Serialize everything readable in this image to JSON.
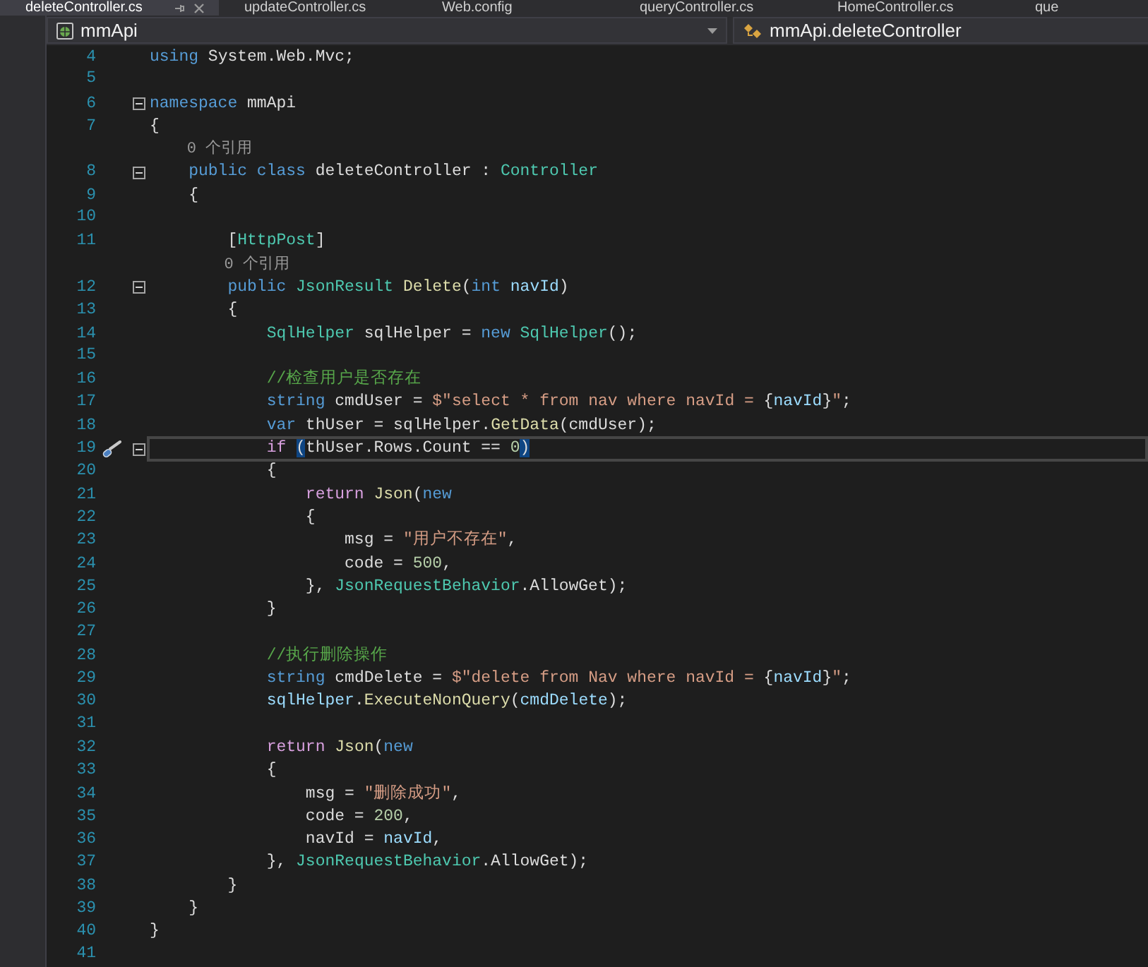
{
  "tabs": [
    {
      "label": "deleteController.cs",
      "selected": true
    },
    {
      "label": "updateController.cs",
      "selected": false
    },
    {
      "label": "Web.config",
      "selected": false
    },
    {
      "label": "queryController.cs",
      "selected": false
    },
    {
      "label": "HomeController.cs",
      "selected": false
    },
    {
      "label": "que",
      "selected": false
    }
  ],
  "navigation_bar": {
    "project": "mmApi",
    "member": "mmApi.deleteController"
  },
  "lines": [
    {
      "number": "4",
      "tokens": [
        {
          "kind": "kw",
          "text": "using"
        },
        {
          "kind": "pl",
          "text": " System.Web.Mvc;"
        }
      ]
    },
    {
      "number": "5"
    },
    {
      "number": "6",
      "fold": true,
      "tokens": [
        {
          "kind": "kw",
          "text": "namespace"
        },
        {
          "kind": "pl",
          "text": " mmApi"
        }
      ]
    },
    {
      "number": "7",
      "tokens": [
        {
          "kind": "pl",
          "text": "{"
        }
      ]
    },
    {
      "kind": "lens",
      "text": "    0 个引用"
    },
    {
      "number": "8",
      "fold": true,
      "tokens": [
        {
          "kind": "kw",
          "text": "    public"
        },
        {
          "kind": "kw",
          "text": " class"
        },
        {
          "kind": "pl",
          "text": " deleteController : "
        },
        {
          "kind": "type",
          "text": "Controller"
        }
      ]
    },
    {
      "number": "9",
      "tokens": [
        {
          "kind": "pl",
          "text": "    {"
        }
      ]
    },
    {
      "number": "10"
    },
    {
      "number": "11",
      "tokens": [
        {
          "kind": "pl",
          "text": "        ["
        },
        {
          "kind": "type",
          "text": "HttpPost"
        },
        {
          "kind": "pl",
          "text": "]"
        }
      ]
    },
    {
      "kind": "lens",
      "text": "        0 个引用"
    },
    {
      "number": "12",
      "fold": true,
      "tokens": [
        {
          "kind": "kw",
          "text": "        public"
        },
        {
          "kind": "type",
          "text": " JsonResult"
        },
        {
          "kind": "meth",
          "text": " Delete"
        },
        {
          "kind": "pl",
          "text": "("
        },
        {
          "kind": "kw",
          "text": "int"
        },
        {
          "kind": "var",
          "text": " navId"
        },
        {
          "kind": "pl",
          "text": ")"
        }
      ]
    },
    {
      "number": "13",
      "tokens": [
        {
          "kind": "pl",
          "text": "        {"
        }
      ]
    },
    {
      "number": "14",
      "tokens": [
        {
          "kind": "type",
          "text": "            SqlHelper"
        },
        {
          "kind": "pl",
          "text": " sqlHelper = "
        },
        {
          "kind": "kw",
          "text": "new"
        },
        {
          "kind": "type",
          "text": " SqlHelper"
        },
        {
          "kind": "pl",
          "text": "();"
        }
      ]
    },
    {
      "number": "15"
    },
    {
      "number": "16",
      "tokens": [
        {
          "kind": "cmt",
          "text": "            //检查用户是否存在"
        }
      ]
    },
    {
      "number": "17",
      "tokens": [
        {
          "kind": "kw",
          "text": "            string"
        },
        {
          "kind": "pl",
          "text": " cmdUser = "
        },
        {
          "kind": "str",
          "text": "$\"select * from nav where navId = "
        },
        {
          "kind": "pl",
          "text": "{"
        },
        {
          "kind": "var",
          "text": "navId"
        },
        {
          "kind": "pl",
          "text": "}"
        },
        {
          "kind": "str",
          "text": "\""
        },
        {
          "kind": "pl",
          "text": ";"
        }
      ]
    },
    {
      "number": "18",
      "tokens": [
        {
          "kind": "kw",
          "text": "            var"
        },
        {
          "kind": "pl",
          "text": " thUser = sqlHelper."
        },
        {
          "kind": "meth",
          "text": "GetData"
        },
        {
          "kind": "pl",
          "text": "(cmdUser);"
        }
      ]
    },
    {
      "number": "19",
      "fold": true,
      "current": true,
      "quick_action": true,
      "tokens": [
        {
          "kind": "ctl",
          "text": "            if "
        },
        {
          "kind": "match",
          "text": "("
        },
        {
          "kind": "pl",
          "text": "thUser.Rows.Count == "
        },
        {
          "kind": "num",
          "text": "0"
        },
        {
          "kind": "match",
          "text": ")"
        }
      ]
    },
    {
      "number": "20",
      "tokens": [
        {
          "kind": "pl",
          "text": "            {"
        }
      ]
    },
    {
      "number": "21",
      "tokens": [
        {
          "kind": "ctl",
          "text": "                return"
        },
        {
          "kind": "meth",
          "text": " Json"
        },
        {
          "kind": "pl",
          "text": "("
        },
        {
          "kind": "kw",
          "text": "new"
        }
      ]
    },
    {
      "number": "22",
      "tokens": [
        {
          "kind": "pl",
          "text": "                {"
        }
      ]
    },
    {
      "number": "23",
      "tokens": [
        {
          "kind": "pl",
          "text": "                    msg = "
        },
        {
          "kind": "str",
          "text": "\"用户不存在\""
        },
        {
          "kind": "pl",
          "text": ","
        }
      ]
    },
    {
      "number": "24",
      "tokens": [
        {
          "kind": "pl",
          "text": "                    code = "
        },
        {
          "kind": "num",
          "text": "500"
        },
        {
          "kind": "pl",
          "text": ","
        }
      ]
    },
    {
      "number": "25",
      "tokens": [
        {
          "kind": "pl",
          "text": "                }, "
        },
        {
          "kind": "type",
          "text": "JsonRequestBehavior"
        },
        {
          "kind": "pl",
          "text": ".AllowGet);"
        }
      ]
    },
    {
      "number": "26",
      "tokens": [
        {
          "kind": "pl",
          "text": "            }"
        }
      ]
    },
    {
      "number": "27"
    },
    {
      "number": "28",
      "tokens": [
        {
          "kind": "cmt",
          "text": "            //执行删除操作"
        }
      ]
    },
    {
      "number": "29",
      "tokens": [
        {
          "kind": "kw",
          "text": "            string"
        },
        {
          "kind": "pl",
          "text": " cmdDelete = "
        },
        {
          "kind": "str",
          "text": "$\"delete from Nav where navId = "
        },
        {
          "kind": "pl",
          "text": "{"
        },
        {
          "kind": "var",
          "text": "navId"
        },
        {
          "kind": "pl",
          "text": "}"
        },
        {
          "kind": "str",
          "text": "\""
        },
        {
          "kind": "pl",
          "text": ";"
        }
      ]
    },
    {
      "number": "30",
      "tokens": [
        {
          "kind": "var",
          "text": "            sqlHelper"
        },
        {
          "kind": "pl",
          "text": "."
        },
        {
          "kind": "meth",
          "text": "ExecuteNonQuery"
        },
        {
          "kind": "pl",
          "text": "("
        },
        {
          "kind": "var",
          "text": "cmdDelete"
        },
        {
          "kind": "pl",
          "text": ");"
        }
      ]
    },
    {
      "number": "31"
    },
    {
      "number": "32",
      "tokens": [
        {
          "kind": "ctl",
          "text": "            return"
        },
        {
          "kind": "meth",
          "text": " Json"
        },
        {
          "kind": "pl",
          "text": "("
        },
        {
          "kind": "kw",
          "text": "new"
        }
      ]
    },
    {
      "number": "33",
      "tokens": [
        {
          "kind": "pl",
          "text": "            {"
        }
      ]
    },
    {
      "number": "34",
      "tokens": [
        {
          "kind": "pl",
          "text": "                msg = "
        },
        {
          "kind": "str",
          "text": "\"删除成功\""
        },
        {
          "kind": "pl",
          "text": ","
        }
      ]
    },
    {
      "number": "35",
      "tokens": [
        {
          "kind": "pl",
          "text": "                code = "
        },
        {
          "kind": "num",
          "text": "200"
        },
        {
          "kind": "pl",
          "text": ","
        }
      ]
    },
    {
      "number": "36",
      "tokens": [
        {
          "kind": "pl",
          "text": "                navId = "
        },
        {
          "kind": "var",
          "text": "navId"
        },
        {
          "kind": "pl",
          "text": ","
        }
      ]
    },
    {
      "number": "37",
      "tokens": [
        {
          "kind": "pl",
          "text": "            }, "
        },
        {
          "kind": "type",
          "text": "JsonRequestBehavior"
        },
        {
          "kind": "pl",
          "text": ".AllowGet);"
        }
      ]
    },
    {
      "number": "38",
      "tokens": [
        {
          "kind": "pl",
          "text": "        }"
        }
      ]
    },
    {
      "number": "39",
      "tokens": [
        {
          "kind": "pl",
          "text": "    }"
        }
      ]
    },
    {
      "number": "40",
      "tokens": [
        {
          "kind": "pl",
          "text": "}"
        }
      ]
    },
    {
      "number": "41"
    }
  ]
}
